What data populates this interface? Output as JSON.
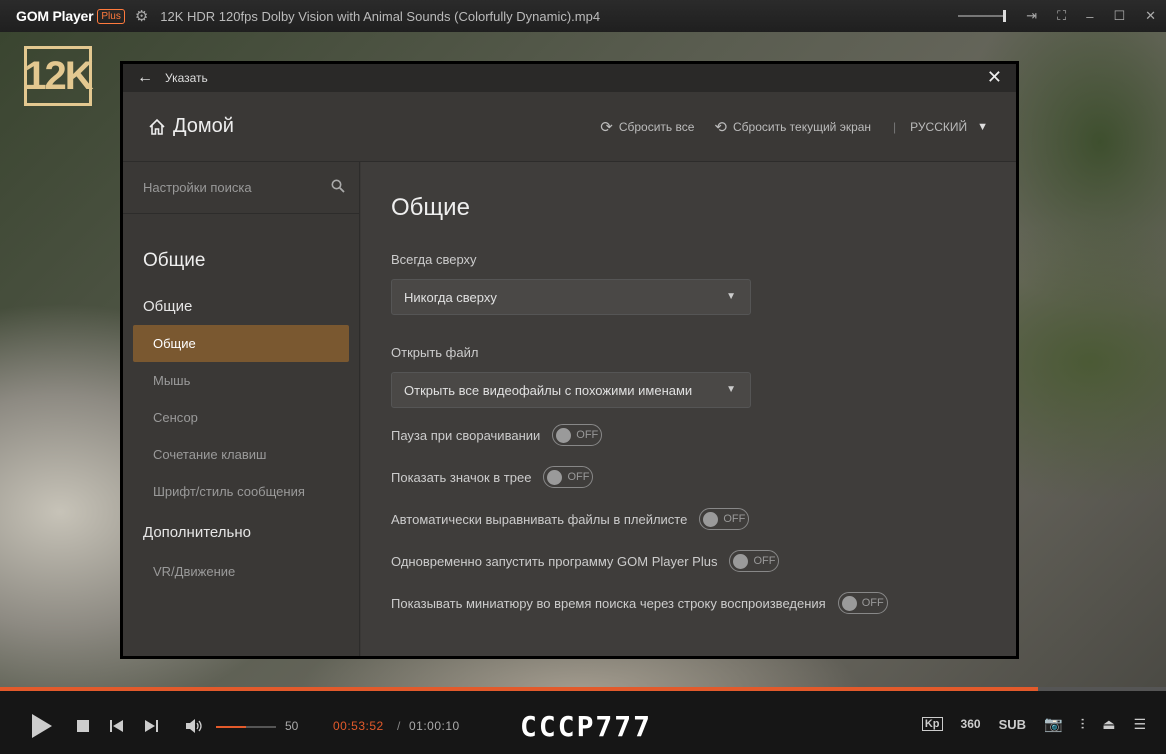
{
  "titlebar": {
    "brand": "GOM Player",
    "plus": "Plus",
    "filename": "12K HDR 120fps Dolby Vision with Animal Sounds (Colorfully Dynamic).mp4"
  },
  "video": {
    "logo": "12K"
  },
  "dialog": {
    "top_title": "Указать",
    "home_label": "Домой",
    "reset_all": "Сбросить все",
    "reset_current": "Сбросить текущий экран",
    "separator": "|",
    "language": "РУССКИЙ",
    "search_placeholder": "Настройки поиска",
    "sidebar": {
      "title": "Общие",
      "category1": "Общие",
      "items": [
        "Общие",
        "Мышь",
        "Сенсор",
        "Сочетание клавиш",
        "Шрифт/стиль сообщения"
      ],
      "category2": "Дополнительно",
      "items2": [
        "VR/Движение"
      ]
    },
    "content": {
      "title": "Общие",
      "always_on_top_label": "Всегда сверху",
      "always_on_top_value": "Никогда сверху",
      "open_file_label": "Открыть файл",
      "open_file_value": "Открыть все видеофайлы с похожими именами",
      "toggles": [
        {
          "label": "Пауза при сворачивании",
          "state": "OFF"
        },
        {
          "label": "Показать значок в трее",
          "state": "OFF"
        },
        {
          "label": "Автоматически выравнивать файлы в плейлисте",
          "state": "OFF"
        },
        {
          "label": "Одновременно запустить программу GOM Player Plus",
          "state": "OFF"
        },
        {
          "label": "Показывать миниатюру во время поиска через строку воспроизведения",
          "state": "OFF"
        }
      ]
    }
  },
  "player": {
    "progress_fraction": 0.89,
    "volume": "50",
    "volume_fraction": 0.5,
    "current_time": "00:53:52",
    "time_separator": "/",
    "total_time": "01:00:10",
    "codec_label": "CCCP777",
    "sub_label": "SUB",
    "vr_label": "360"
  },
  "colors": {
    "accent": "#e35a2b",
    "active_item": "#7a5830"
  }
}
